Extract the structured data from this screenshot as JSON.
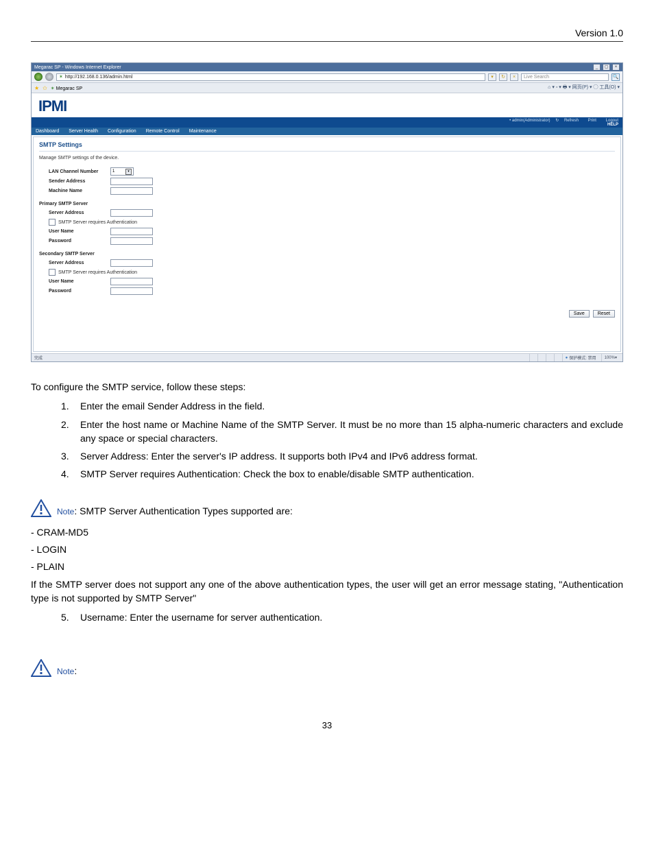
{
  "doc": {
    "version_header": "Version 1.0",
    "page_number": "33"
  },
  "browser": {
    "title": "Megarac SP - Windows Internet Explorer",
    "url": "http://192.168.0.136/admin.html",
    "search_placeholder": "Live Search",
    "tab_title": "Megarac SP",
    "tools": "网页(P) ▾ ◯ 工具(O) ▾",
    "status_left": "完成",
    "status_right": "保护模式: 禁用",
    "zoom": "100%"
  },
  "ipmi": {
    "logo": "IPMI",
    "user": "• admin(Administrator)",
    "refresh": "Refresh",
    "print": "Print",
    "logout": "Logout",
    "help": "HELP",
    "nav": [
      "Dashboard",
      "Server Health",
      "Configuration",
      "Remote Control",
      "Maintenance"
    ],
    "section_title": "SMTP Settings",
    "section_sub": "Manage SMTP settings of the device.",
    "labels": {
      "lan_channel": "LAN Channel Number",
      "lan_value": "1",
      "sender": "Sender Address",
      "machine": "Machine Name",
      "primary_header": "Primary SMTP Server",
      "secondary_header": "Secondary SMTP Server",
      "server_addr": "Server Address",
      "requires_auth": "SMTP Server requires Authentication",
      "username": "User Name",
      "password": "Password"
    },
    "buttons": {
      "save": "Save",
      "reset": "Reset"
    }
  },
  "body": {
    "intro": "To configure the SMTP service, follow these steps:",
    "step1": "Enter the email Sender Address in the field.",
    "step2": "Enter the host name or Machine Name of the SMTP Server. It must be no more than 15 alpha-numeric characters and exclude any space or special characters.",
    "step3": "Server Address: Enter the server's IP address. It supports both IPv4 and IPv6 address format.",
    "step4": "SMTP Server requires Authentication: Check the box to enable/disable SMTP authentication.",
    "note1_label": "Note",
    "note1_text": ": SMTP Server Authentication Types supported are:",
    "auth1": "- CRAM-MD5",
    "auth2": "- LOGIN",
    "auth3": "- PLAIN",
    "auth_warn": "If the SMTP server does not support any one of the above authentication types, the user will get an error message stating, \"Authentication type is not supported by SMTP Server\"",
    "step5": "Username: Enter the username for server authentication.",
    "note2_label": "Note",
    "note2_colon": ":"
  }
}
